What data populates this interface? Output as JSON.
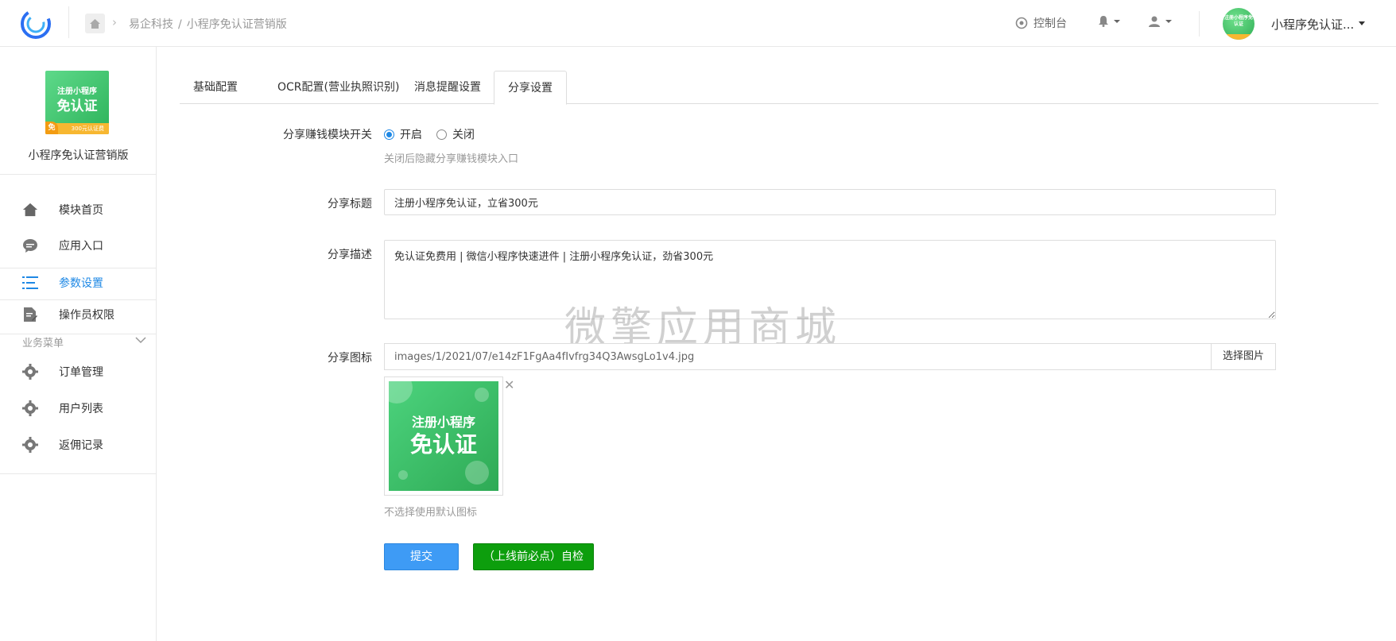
{
  "header": {
    "breadcrumb": [
      "易企科技",
      "小程序免认证营销版"
    ],
    "breadcrumb_sep": "/",
    "console_label": "控制台",
    "app_name": "小程序免认证..."
  },
  "avatar_text": "注册小程序免认证",
  "sidebar": {
    "logo_line1": "注册小程序",
    "logo_line2": "免认证",
    "logo_bar": "300元认证费",
    "logo_badge": "免",
    "app_name": "小程序免认证营销版",
    "items": [
      {
        "label": "模块首页",
        "icon": "home-icon"
      },
      {
        "label": "应用入口",
        "icon": "chat-icon"
      },
      {
        "label": "参数设置",
        "icon": "list-icon",
        "active": true
      },
      {
        "label": "操作员权限",
        "icon": "document-edit-icon"
      }
    ],
    "section_title": "业务菜单",
    "business_items": [
      {
        "label": "订单管理",
        "icon": "gear-icon"
      },
      {
        "label": "用户列表",
        "icon": "gear-icon"
      },
      {
        "label": "返佣记录",
        "icon": "gear-icon"
      }
    ]
  },
  "tabs": [
    "基础配置",
    "OCR配置(营业执照识别)",
    "消息提醒设置",
    "分享设置"
  ],
  "active_tab": "分享设置",
  "form": {
    "switch_label": "分享赚钱模块开关",
    "switch_on": "开启",
    "switch_off": "关闭",
    "switch_value": "开启",
    "switch_hint": "关闭后隐藏分享赚钱模块入口",
    "title_label": "分享标题",
    "title_value": "注册小程序免认证，立省300元",
    "desc_label": "分享描述",
    "desc_value": "免认证免费用 | 微信小程序快速进件 | 注册小程序免认证，劲省300元",
    "icon_label": "分享图标",
    "icon_path": "images/1/2021/07/e14zF1FgAa4fIvfrg34Q3AwsgLo1v4.jpg",
    "pick_button": "选择图片",
    "thumb_line1": "注册小程序",
    "thumb_line2": "免认证",
    "icon_hint": "不选择使用默认图标",
    "close_glyph": "✕"
  },
  "buttons": {
    "submit": "提交",
    "self_check": "（上线前必点）自检"
  },
  "watermark": "微擎应用商城",
  "colors": {
    "accent": "#1e88e5",
    "submit": "#3e9bf5",
    "check": "#0d9e0d",
    "brand_green": "#2fae55"
  }
}
